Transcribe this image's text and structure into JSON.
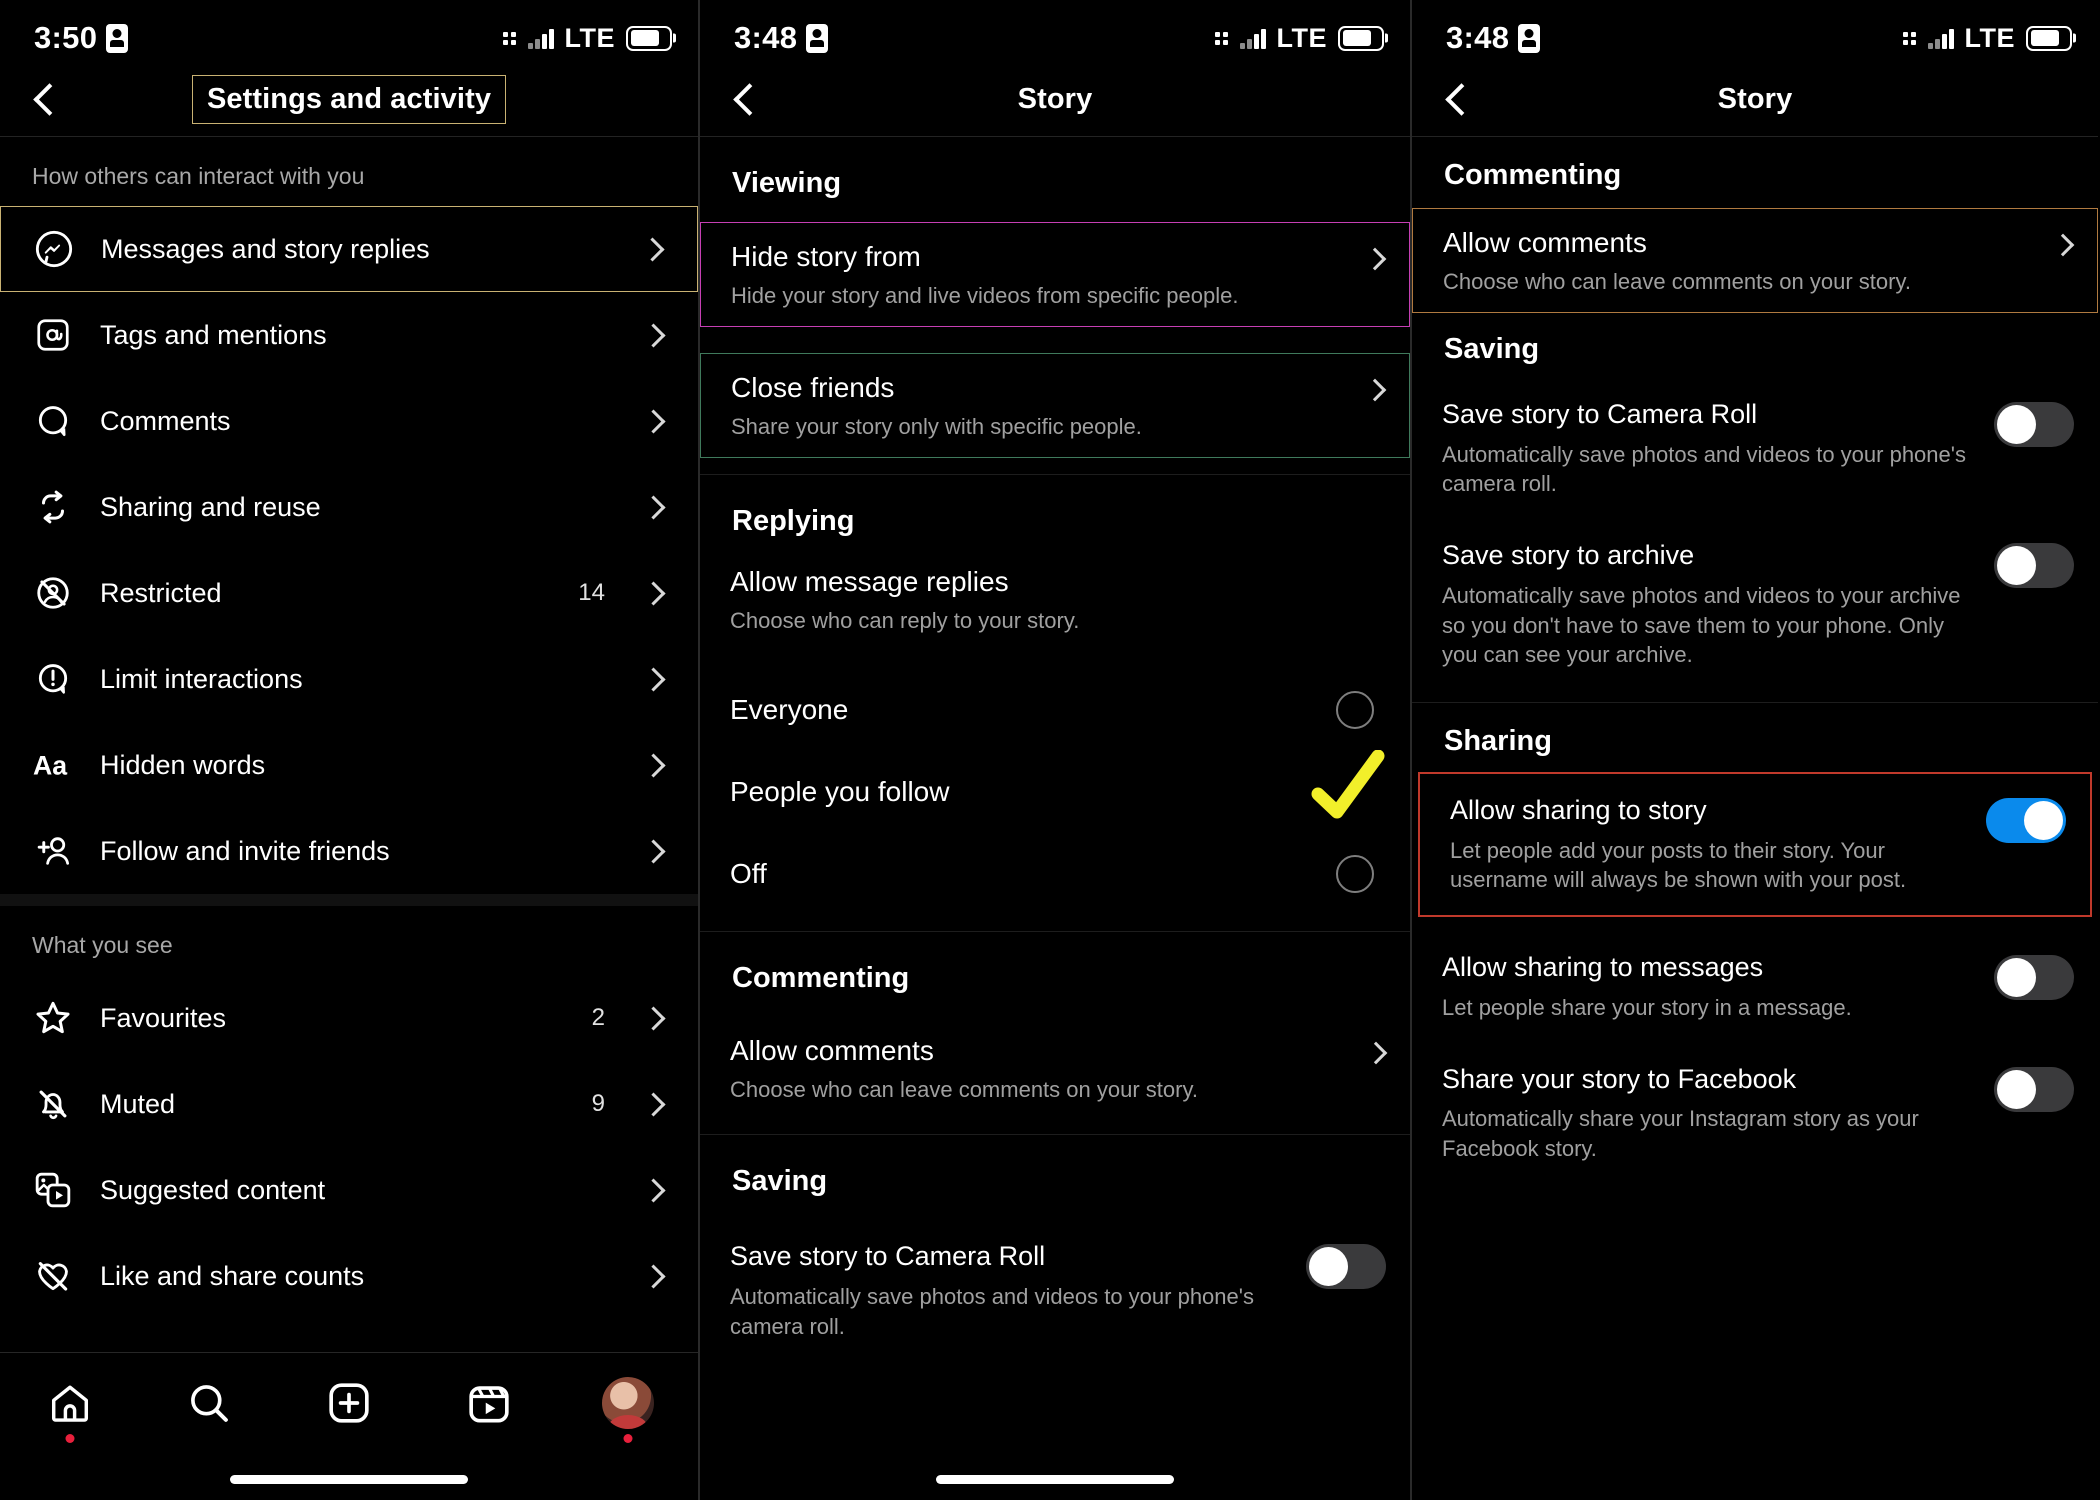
{
  "panel1": {
    "status": {
      "time": "3:50",
      "network": "LTE",
      "badge_icon": "sim-card-icon"
    },
    "nav": {
      "title": "Settings and activity",
      "back_icon": "back-chevron-icon"
    },
    "sections": [
      {
        "label": "How others can interact with you",
        "items": [
          {
            "label": "Messages and story replies",
            "icon": "messenger-icon",
            "count": "",
            "highlight": "gold"
          },
          {
            "label": "Tags and mentions",
            "icon": "at-mention-icon",
            "count": ""
          },
          {
            "label": "Comments",
            "icon": "comment-bubble-icon",
            "count": ""
          },
          {
            "label": "Sharing and reuse",
            "icon": "repeat-arrows-icon",
            "count": ""
          },
          {
            "label": "Restricted",
            "icon": "restricted-user-icon",
            "count": "14"
          },
          {
            "label": "Limit interactions",
            "icon": "exclamation-bubble-icon",
            "count": ""
          },
          {
            "label": "Hidden words",
            "icon": "aa-text-icon",
            "count": ""
          },
          {
            "label": "Follow and invite friends",
            "icon": "add-person-icon",
            "count": ""
          }
        ]
      },
      {
        "label": "What you see",
        "items": [
          {
            "label": "Favourites",
            "icon": "star-icon",
            "count": "2"
          },
          {
            "label": "Muted",
            "icon": "muted-bell-icon",
            "count": "9"
          },
          {
            "label": "Suggested content",
            "icon": "media-stack-icon",
            "count": ""
          },
          {
            "label": "Like and share counts",
            "icon": "crossed-heart-icon",
            "count": ""
          }
        ]
      }
    ],
    "tabbar": [
      {
        "name": "home-tab",
        "icon": "home-icon",
        "dot": true
      },
      {
        "name": "search-tab",
        "icon": "search-icon",
        "dot": false
      },
      {
        "name": "create-tab",
        "icon": "plus-square-icon",
        "dot": false
      },
      {
        "name": "reels-tab",
        "icon": "reels-icon",
        "dot": false
      },
      {
        "name": "profile-tab",
        "icon": "avatar-icon",
        "dot": true
      }
    ]
  },
  "panel2": {
    "status": {
      "time": "3:48",
      "network": "LTE",
      "badge_icon": "sim-card-icon"
    },
    "nav": {
      "title": "Story",
      "back_icon": "back-chevron-icon"
    },
    "viewing_title": "Viewing",
    "viewing_items": [
      {
        "title": "Hide story from",
        "subtitle": "Hide your story and live videos from specific people.",
        "highlight": "magenta"
      },
      {
        "title": "Close friends",
        "subtitle": "Share your story only with specific people.",
        "highlight": "green"
      }
    ],
    "replying_title": "Replying",
    "replying_item": {
      "title": "Allow message replies",
      "subtitle": "Choose who can reply to your story."
    },
    "replying_options": [
      {
        "label": "Everyone",
        "selected": false
      },
      {
        "label": "People you follow",
        "selected": true
      },
      {
        "label": "Off",
        "selected": false
      }
    ],
    "commenting_title": "Commenting",
    "commenting_item": {
      "title": "Allow comments",
      "subtitle": "Choose who can leave comments on your story."
    },
    "saving_title": "Saving",
    "saving_item": {
      "title": "Save story to Camera Roll",
      "subtitle": "Automatically save photos and videos to your phone's camera roll.",
      "on": false
    }
  },
  "panel3": {
    "status": {
      "time": "3:48",
      "network": "LTE",
      "badge_icon": "sim-card-icon"
    },
    "nav": {
      "title": "Story",
      "back_icon": "back-chevron-icon"
    },
    "commenting_title": "Commenting",
    "commenting_item": {
      "title": "Allow comments",
      "subtitle": "Choose who can leave comments on your story.",
      "highlight": "orange"
    },
    "saving_title": "Saving",
    "saving_items": [
      {
        "title": "Save story to Camera Roll",
        "subtitle": "Automatically save photos and videos to your phone's camera roll.",
        "on": false
      },
      {
        "title": "Save story to archive",
        "subtitle": "Automatically save photos and videos to your archive so you don't have to save them to your phone. Only you can see your archive.",
        "on": false
      }
    ],
    "sharing_title": "Sharing",
    "sharing_items": [
      {
        "title": "Allow sharing to story",
        "subtitle": "Let people add your posts to their story. Your username will always be shown with your post.",
        "on": true,
        "highlight": "red"
      },
      {
        "title": "Allow sharing to messages",
        "subtitle": "Let people share your story in a message.",
        "on": false
      },
      {
        "title": "Share your story to Facebook",
        "subtitle": "Automatically share your Instagram story as your Facebook story.",
        "on": false
      }
    ]
  },
  "colors": {
    "background": "#000000",
    "toggle_on": "#0a8aec",
    "highlight_gold": "#c9b273",
    "highlight_magenta": "#c63fb4",
    "highlight_green": "#3f7a5c",
    "highlight_orange": "#b07a40",
    "highlight_red": "#c0392b",
    "check_yellow": "#f2ef2a",
    "notification_dot": "#e8203c"
  }
}
